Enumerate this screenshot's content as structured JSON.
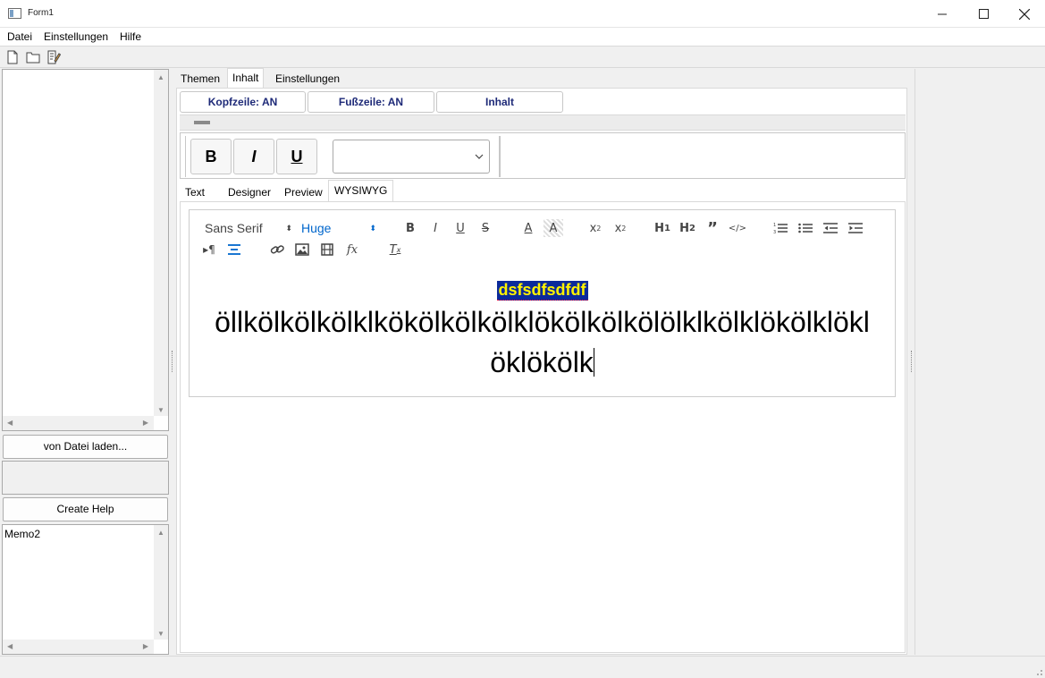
{
  "window": {
    "title": "Form1"
  },
  "menu": {
    "items": [
      "Datei",
      "Einstellungen",
      "Hilfe"
    ]
  },
  "toolbar": {
    "icons": [
      "new-file-icon",
      "open-folder-icon",
      "edit-document-icon"
    ]
  },
  "left": {
    "load_button": "von Datei laden...",
    "create_help_button": "Create Help",
    "memo_text": "Memo2"
  },
  "tabs": {
    "items": [
      "Themen",
      "Inhalt",
      "Einstellungen"
    ],
    "active": "Inhalt"
  },
  "header_buttons": {
    "kopfzeile": "Kopfzeile: AN",
    "fusszeile": "Fußzeile: AN",
    "inhalt": "Inhalt"
  },
  "format": {
    "bold": "B",
    "italic": "I",
    "underline": "U",
    "combo_value": ""
  },
  "subtabs": {
    "items": [
      "Text",
      "Designer",
      "Preview",
      "WYSIWYG"
    ],
    "active": "WYSIWYG"
  },
  "editor": {
    "font_picker": "Sans Serif",
    "size_picker": "Huge",
    "highlight_text": "dsfsdfsdfdf",
    "line1": "öllkölkölkölklkökölkölkölklököl­kölkölölklkölklökölklökl",
    "line2": "öklökölk",
    "accent_color": "#06c",
    "highlight_bg": "#0b2a9a",
    "highlight_fg": "#fff200"
  }
}
